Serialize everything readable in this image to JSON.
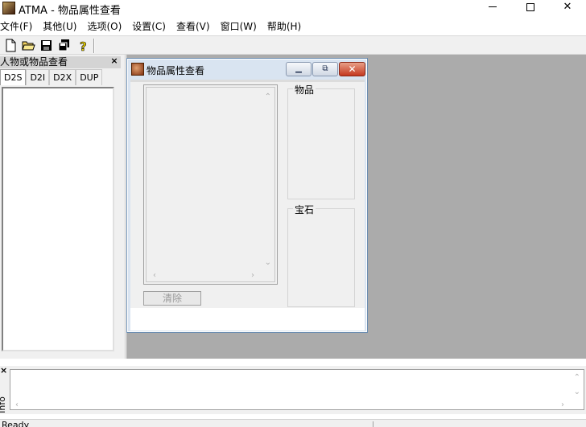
{
  "app": {
    "title": "ATMA - 物品属性查看",
    "min_label": "—",
    "max_label": "☐",
    "close_label": "✕"
  },
  "menu": [
    "文件(F)",
    "其他(U)",
    "选项(O)",
    "设置(C)",
    "查看(V)",
    "窗口(W)",
    "帮助(H)"
  ],
  "toolbar": {
    "buttons": [
      "new-file-icon",
      "open-folder-icon",
      "save-icon",
      "save-all-icon",
      "help-icon"
    ]
  },
  "dock": {
    "title": "人物或物品查看",
    "close_label": "×",
    "tabs": [
      "D2S",
      "D2I",
      "D2X",
      "DUP"
    ],
    "active_tab": "D2S"
  },
  "child_window": {
    "title": "物品属性查看",
    "clear_button": "清除",
    "group_items_label": "物品",
    "group_gems_label": "宝石",
    "close_label": "✕"
  },
  "output": {
    "side_label": "Info",
    "close_label": "×"
  },
  "status": {
    "text": "Ready"
  }
}
